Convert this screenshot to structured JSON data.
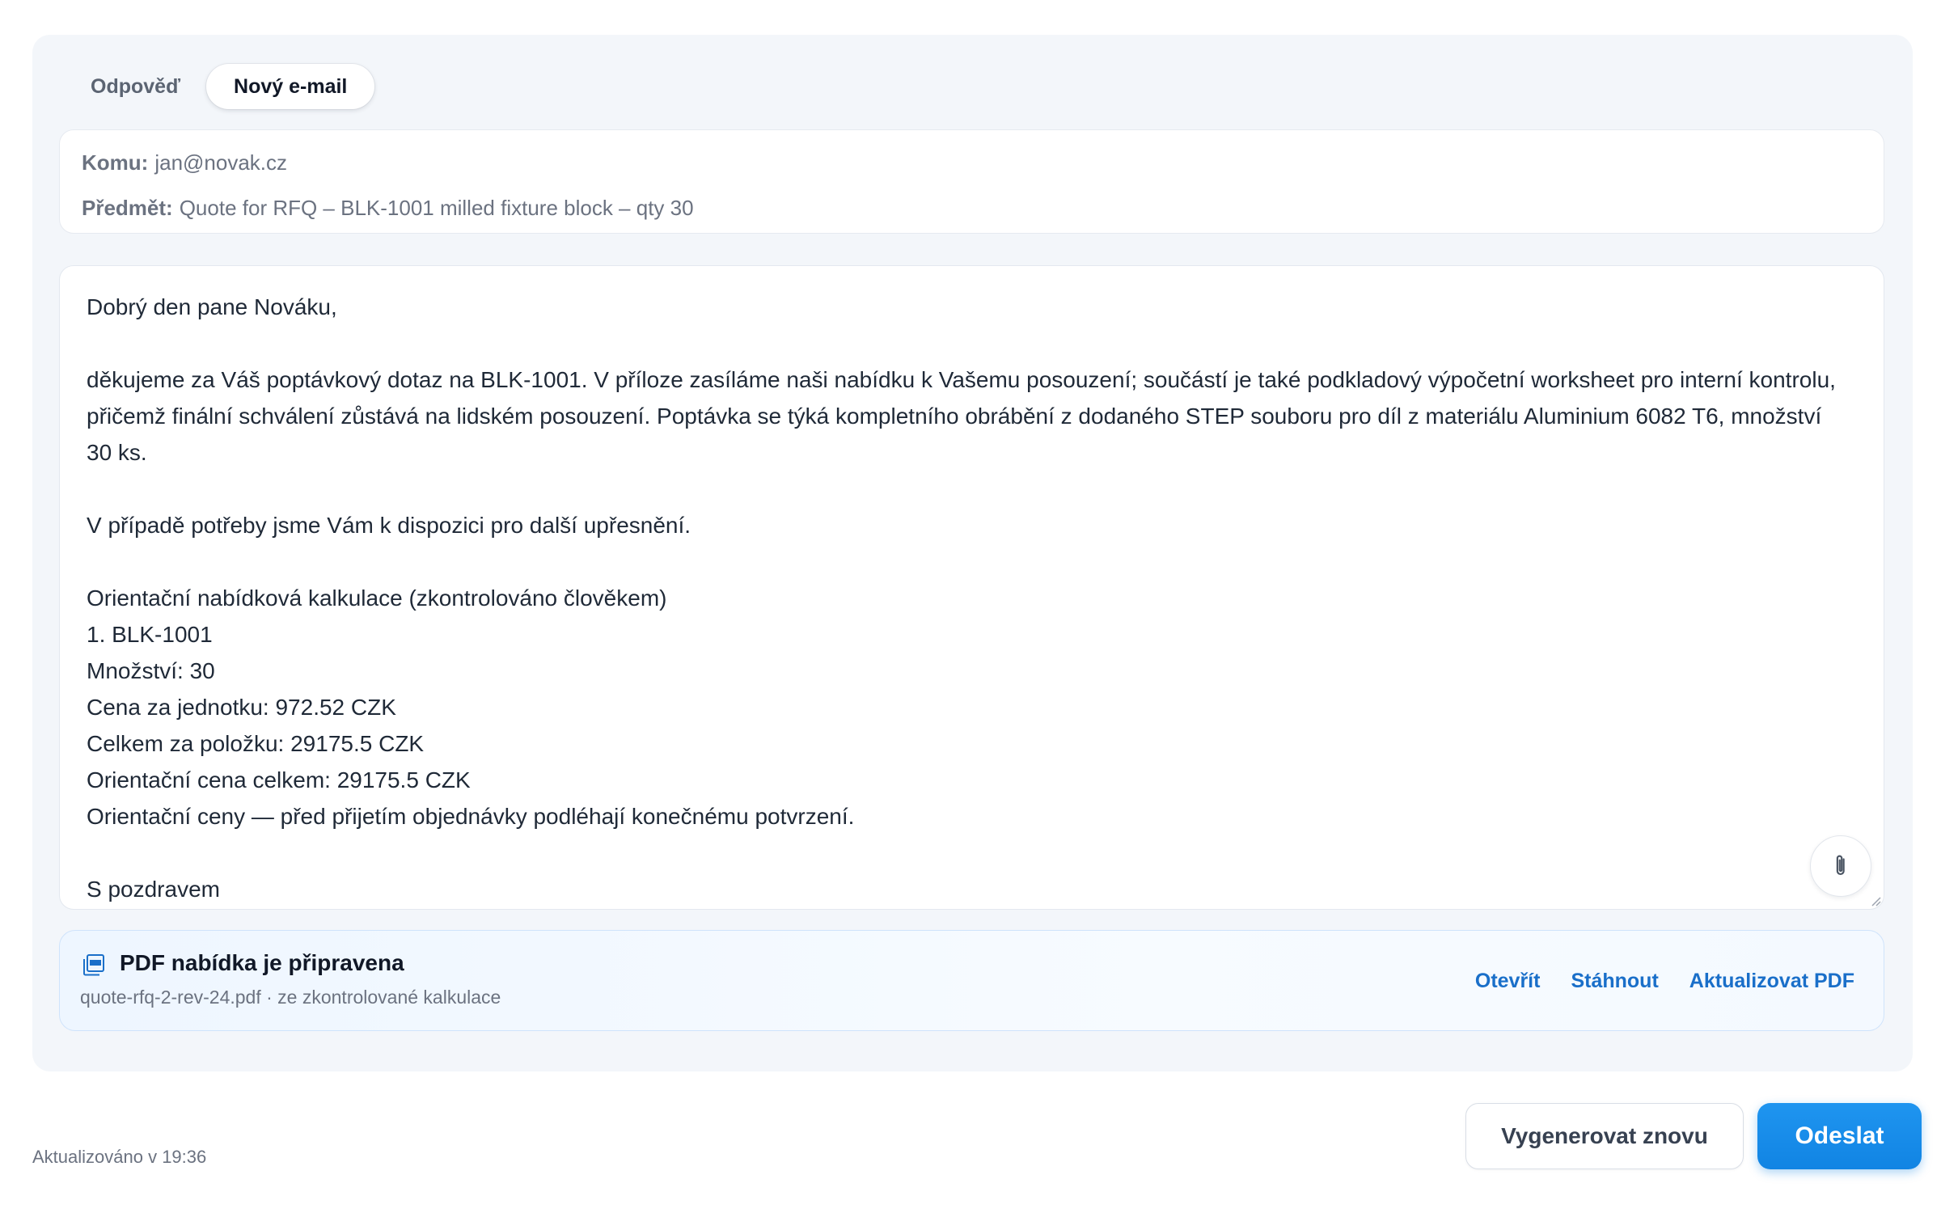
{
  "tabs": [
    {
      "label": "Odpověď",
      "active": false
    },
    {
      "label": "Nový e-mail",
      "active": true
    }
  ],
  "meta": {
    "to_label": "Komu:",
    "to_value": "jan@novak.cz",
    "subject_label": "Předmět:",
    "subject_value": "Quote for RFQ – BLK-1001 milled fixture block – qty 30"
  },
  "body": {
    "greeting": "Dobrý den pane Nováku,",
    "paragraph1": "děkujeme za Váš poptávkový dotaz na BLK-1001. V příloze zasíláme naši nabídku k Vašemu posouzení; součástí je také podkladový výpočetní worksheet pro interní kontrolu, přičemž finální schválení zůstává na lidském posouzení. Poptávka se týká kompletního obrábění z dodaného STEP souboru pro díl z materiálu Aluminium 6082 T6, množství 30 ks.",
    "paragraph2": "V případě potřeby jsme Vám k dispozici pro další upřesnění.",
    "calc_title": "Orientační nabídková kalkulace (zkontrolováno člověkem)",
    "calc_item": "1. BLK-1001",
    "calc_qty": "Množství: 30",
    "calc_unit_price": "Cena za jednotku: 972.52 CZK",
    "calc_line_total": "Celkem za položku: 29175.5 CZK",
    "calc_total": "Orientační cena celkem: 29175.5 CZK",
    "calc_note": "Orientační ceny — před přijetím objednávky podléhají konečnému potvrzení.",
    "closing": "S pozdravem"
  },
  "pdf": {
    "icon": "pdf-file-icon",
    "title": "PDF nabídka je připravena",
    "subtitle": "quote-rfq-2-rev-24.pdf · ze zkontrolované kalkulace",
    "actions": {
      "open": "Otevřít",
      "download": "Stáhnout",
      "update": "Aktualizovat PDF"
    }
  },
  "footer": {
    "updated": "Aktualizováno v 19:36",
    "regenerate": "Vygenerovat znovu",
    "send": "Odeslat"
  },
  "colors": {
    "accent": "#1184e3",
    "link": "#1a6fc9",
    "panel_bg": "#f3f6fa",
    "pdf_card_border": "#cfe3fb"
  }
}
